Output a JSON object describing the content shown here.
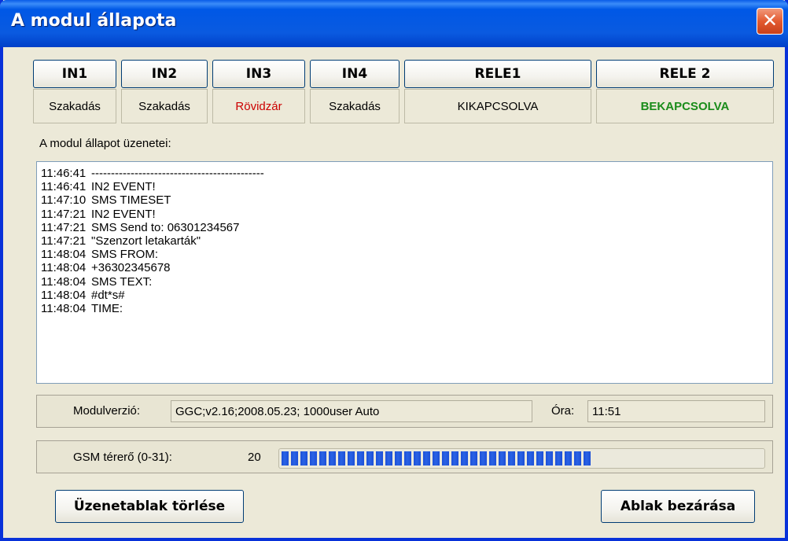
{
  "window": {
    "title": "A modul állapota",
    "close_symbol": "✕"
  },
  "status": {
    "inputs": [
      {
        "label": "IN1",
        "value": "Szakadás",
        "color": "#000000"
      },
      {
        "label": "IN2",
        "value": "Szakadás",
        "color": "#000000"
      },
      {
        "label": "IN3",
        "value": "Rövidzár",
        "color": "#cc0000"
      },
      {
        "label": "IN4",
        "value": "Szakadás",
        "color": "#000000"
      }
    ],
    "relays": [
      {
        "label": "RELE1",
        "value": "KIKAPCSOLVA",
        "color": "#000000"
      },
      {
        "label": "RELE 2",
        "value": "BEKAPCSOLVA",
        "color": "#1a8c1a"
      }
    ]
  },
  "messages": {
    "label": "A modul állapot üzenetei:",
    "entries": [
      {
        "time": "11:46:41",
        "text": "--------------------------------------------"
      },
      {
        "time": "11:46:41",
        "text": "IN2 EVENT!"
      },
      {
        "time": "11:47:10",
        "text": "SMS TIMESET"
      },
      {
        "time": "11:47:21",
        "text": "IN2 EVENT!"
      },
      {
        "time": "11:47:21",
        "text": "SMS Send to: 06301234567"
      },
      {
        "time": "11:47:21",
        "text": "\"Szenzort letakarták\""
      },
      {
        "time": "11:48:04",
        "text": "SMS FROM:"
      },
      {
        "time": "11:48:04",
        "text": "+36302345678"
      },
      {
        "time": "11:48:04",
        "text": "SMS TEXT:"
      },
      {
        "time": "11:48:04",
        "text": "#dt*s#"
      },
      {
        "time": "11:48:04",
        "text": "TIME:"
      }
    ]
  },
  "module": {
    "version_label": "Modulverzió:",
    "version_value": "GGC;v2.16;2008.05.23; 1000user Auto",
    "clock_label": "Óra:",
    "clock_value": "11:51"
  },
  "gsm": {
    "label": "GSM térerő (0-31):",
    "value": "20",
    "level": 20,
    "max": 31
  },
  "buttons": {
    "clear": "Üzenetablak törlése",
    "close": "Ablak bezárása"
  }
}
